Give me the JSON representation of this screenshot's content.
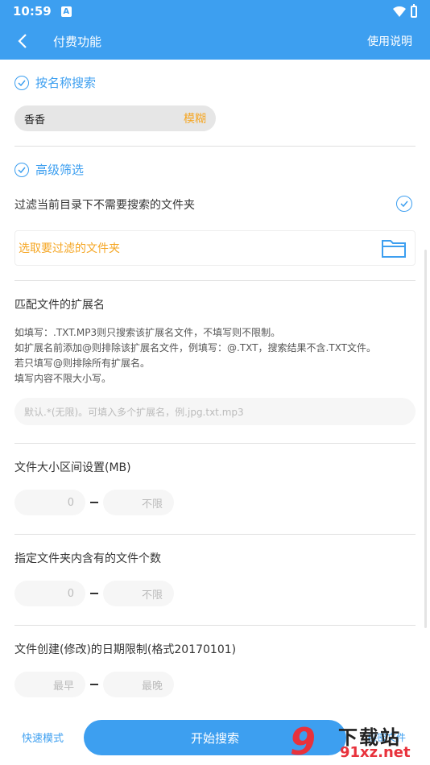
{
  "status_bar": {
    "time": "10:59",
    "app_icon": "A"
  },
  "toolbar": {
    "title": "付费功能",
    "help": "使用说明"
  },
  "name_search": {
    "header": "按名称搜索",
    "value": "香香",
    "mode": "模糊"
  },
  "advanced": {
    "header": "高级筛选",
    "filter_folders_label": "过滤当前目录下不需要搜索的文件夹",
    "choose_folder_label": "选取要过滤的文件夹",
    "ext_title": "匹配文件的扩展名",
    "ext_hint_lines": [
      "如填写：.TXT.MP3则只搜索该扩展名文件，不填写则不限制。",
      "如扩展名前添加@则排除该扩展名文件，例填写：@.TXT，搜索结果不含.TXT文件。",
      "若只填写@则排除所有扩展名。",
      "填写内容不限大小写。"
    ],
    "ext_placeholder": "默认.*(无限)。可填入多个扩展名，例.jpg.txt.mp3",
    "size_title": "文件大小区间设置(MB)",
    "size_min": "0",
    "size_max": "不限",
    "count_title": "指定文件夹内含有的文件个数",
    "count_min": "0",
    "count_max": "不限",
    "date_title": "文件创建(修改)的日期限制(格式20170101)",
    "date_min": "最早",
    "date_max": "最晚"
  },
  "bottom": {
    "quick_mode": "快速模式",
    "start": "开始搜索",
    "secret": "秘密文件"
  },
  "watermark": {
    "num": "9",
    "top": "下载站",
    "bottom": "91xz.net"
  },
  "colors": {
    "accent": "#3d9ff0",
    "highlight": "#f5a623"
  }
}
